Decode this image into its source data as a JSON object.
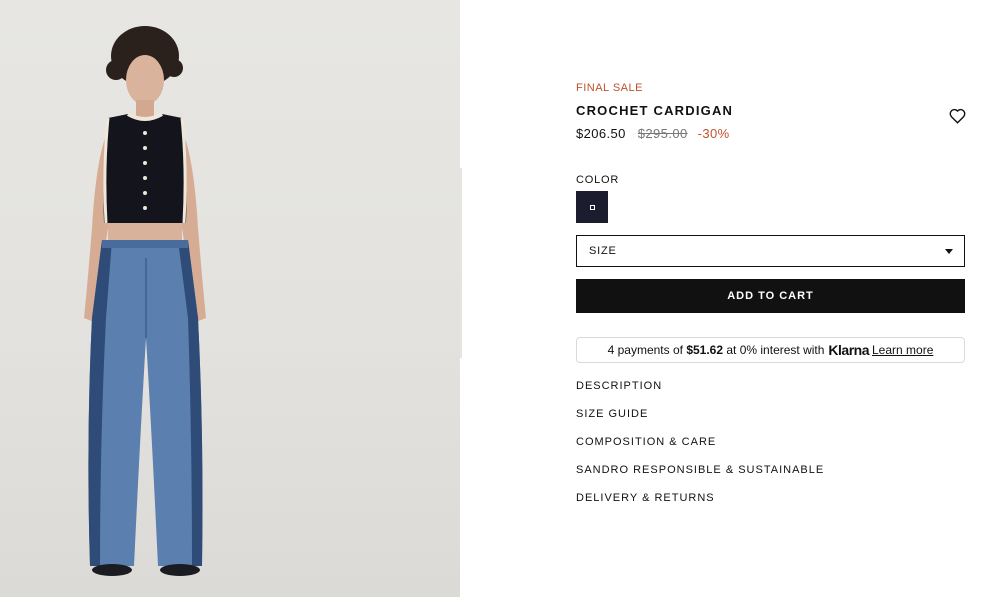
{
  "product": {
    "badge": "FINAL SALE",
    "title": "CROCHET CARDIGAN",
    "price_current": "$206.50",
    "price_original": "$295.00",
    "discount": "-30%"
  },
  "color": {
    "label": "COLOR",
    "swatch_hex": "#1b1c2e"
  },
  "size": {
    "label": "SIZE"
  },
  "cart": {
    "button_label": "ADD TO CART"
  },
  "klarna": {
    "prefix": "4 payments of",
    "amount": "$51.62",
    "suffix": "at 0% interest with",
    "brand": "Klarna",
    "learn_more": "Learn more"
  },
  "accordion": {
    "items": [
      "DESCRIPTION",
      "SIZE GUIDE",
      "COMPOSITION & CARE",
      "SANDRO RESPONSIBLE & SUSTAINABLE",
      "DELIVERY & RETURNS"
    ]
  },
  "colors": {
    "accent_sale": "#c0512b",
    "primary": "#111111"
  },
  "icons": {
    "wishlist": "heart-icon",
    "dropdown": "chevron-down-icon"
  }
}
